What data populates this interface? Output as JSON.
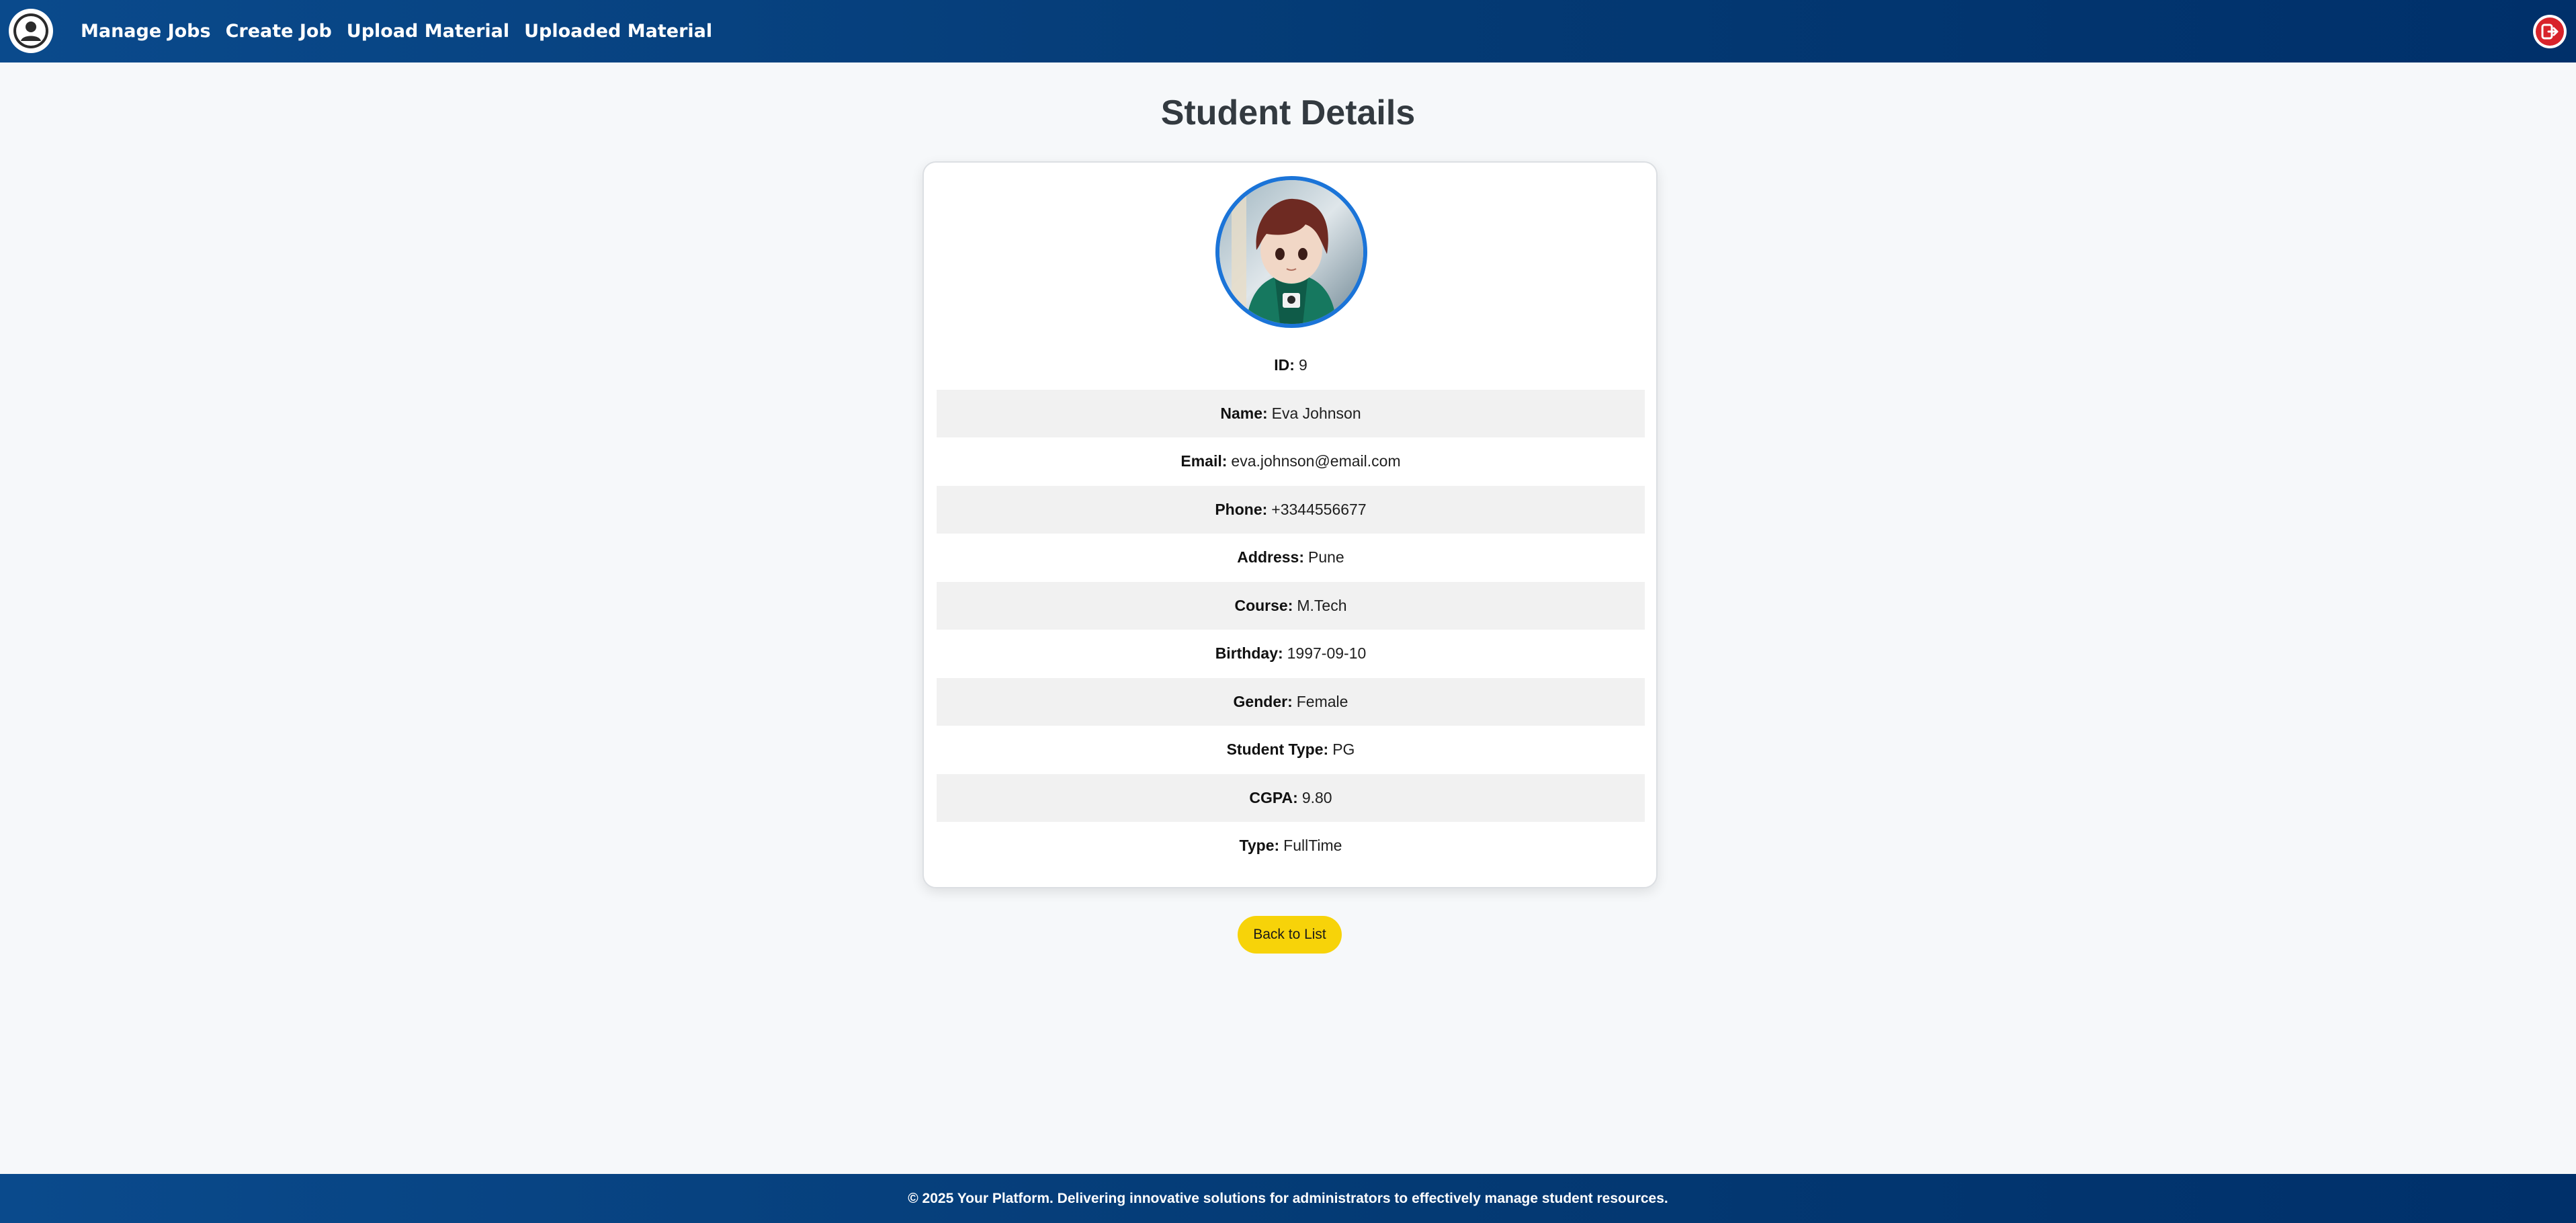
{
  "navbar": {
    "links": [
      "Manage Jobs",
      "Create Job",
      "Upload Material",
      "Uploaded Material"
    ],
    "profile_icon": "user-circle-icon",
    "logout_icon": "logout-icon"
  },
  "page": {
    "title": "Student Details"
  },
  "student": {
    "rows": [
      {
        "label": "ID:",
        "value": "9"
      },
      {
        "label": "Name:",
        "value": "Eva Johnson"
      },
      {
        "label": "Email:",
        "value": "eva.johnson@email.com"
      },
      {
        "label": "Phone:",
        "value": "+3344556677"
      },
      {
        "label": "Address:",
        "value": "Pune"
      },
      {
        "label": "Course:",
        "value": "M.Tech"
      },
      {
        "label": "Birthday:",
        "value": "1997-09-10"
      },
      {
        "label": "Gender:",
        "value": "Female"
      },
      {
        "label": "Student Type:",
        "value": "PG"
      },
      {
        "label": "CGPA:",
        "value": "9.80"
      },
      {
        "label": "Type:",
        "value": "FullTime"
      }
    ]
  },
  "actions": {
    "back_label": "Back to List"
  },
  "footer": {
    "text": "© 2025 Your Platform. Delivering innovative solutions for administrators to effectively manage student resources."
  },
  "colors": {
    "navbar": "#043a74",
    "accent_button": "#f7d309",
    "avatar_border": "#1b74d8",
    "logout": "#d8232a"
  }
}
